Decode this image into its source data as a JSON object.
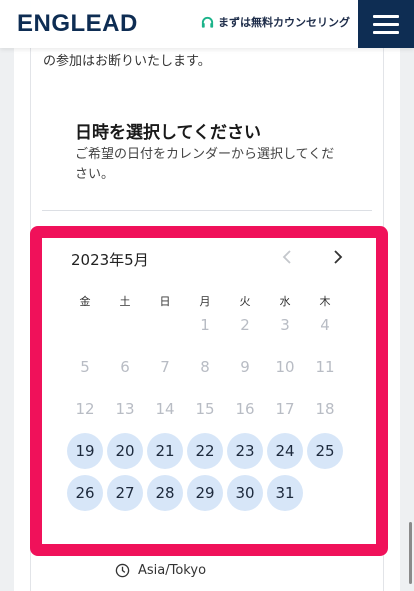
{
  "header": {
    "logo": "ENGLEAD",
    "counseling_label": "まずは無料カウンセリング",
    "menu_icon": "hamburger-menu-icon"
  },
  "intro": {
    "text": "の参加はお断りいたします。"
  },
  "step": {
    "title": "日時を選択してください",
    "description": "ご希望の日付をカレンダーから選択してください。"
  },
  "calendar": {
    "month_label": "2023年5月",
    "weekdays": [
      "金",
      "土",
      "日",
      "月",
      "火",
      "水",
      "木"
    ],
    "weeks": [
      [
        "",
        "",
        "",
        "1",
        "2",
        "3",
        "4"
      ],
      [
        "5",
        "6",
        "7",
        "8",
        "9",
        "10",
        "11"
      ],
      [
        "12",
        "13",
        "14",
        "15",
        "16",
        "17",
        "18"
      ],
      [
        "19",
        "20",
        "21",
        "22",
        "23",
        "24",
        "25"
      ],
      [
        "26",
        "27",
        "28",
        "29",
        "30",
        "31",
        ""
      ]
    ],
    "available_days": [
      "19",
      "20",
      "21",
      "22",
      "23",
      "24",
      "25",
      "26",
      "27",
      "28",
      "29",
      "30",
      "31"
    ]
  },
  "timezone": {
    "label": "Asia/Tokyo"
  },
  "colors": {
    "brand_navy": "#0e2d53",
    "highlight_pink": "#f0115a",
    "available_day_bg": "#d7e6f8",
    "disabled_day_text": "#b8bcc4"
  }
}
